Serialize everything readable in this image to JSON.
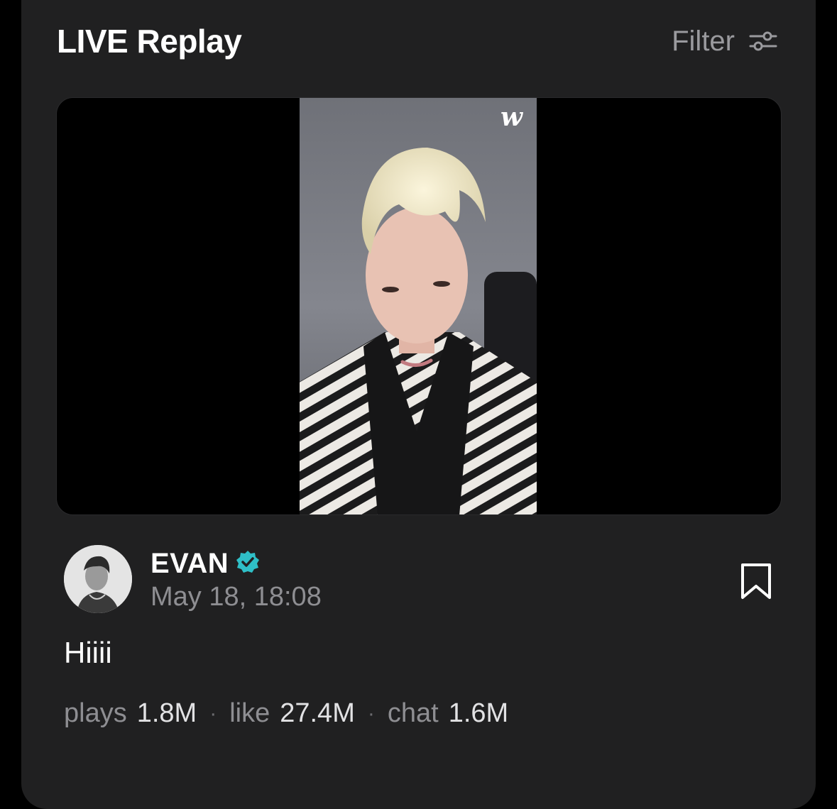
{
  "header": {
    "title": "LIVE Replay",
    "filter_label": "Filter"
  },
  "video": {
    "watermark": "w"
  },
  "post": {
    "author": "EVAN",
    "verified": true,
    "timestamp": "May 18, 18:08",
    "text": "Hiiii"
  },
  "stats": {
    "plays_label": "plays",
    "plays_value": "1.8M",
    "like_label": "like",
    "like_value": "27.4M",
    "chat_label": "chat",
    "chat_value": "1.6M",
    "separator": "·"
  },
  "colors": {
    "card_background": "#202021",
    "verified_badge": "#2fbfc7",
    "muted_text": "#8e8e92"
  },
  "icons": {
    "filter": "sliders-icon",
    "verified": "verified-badge-icon",
    "bookmark": "bookmark-icon"
  }
}
